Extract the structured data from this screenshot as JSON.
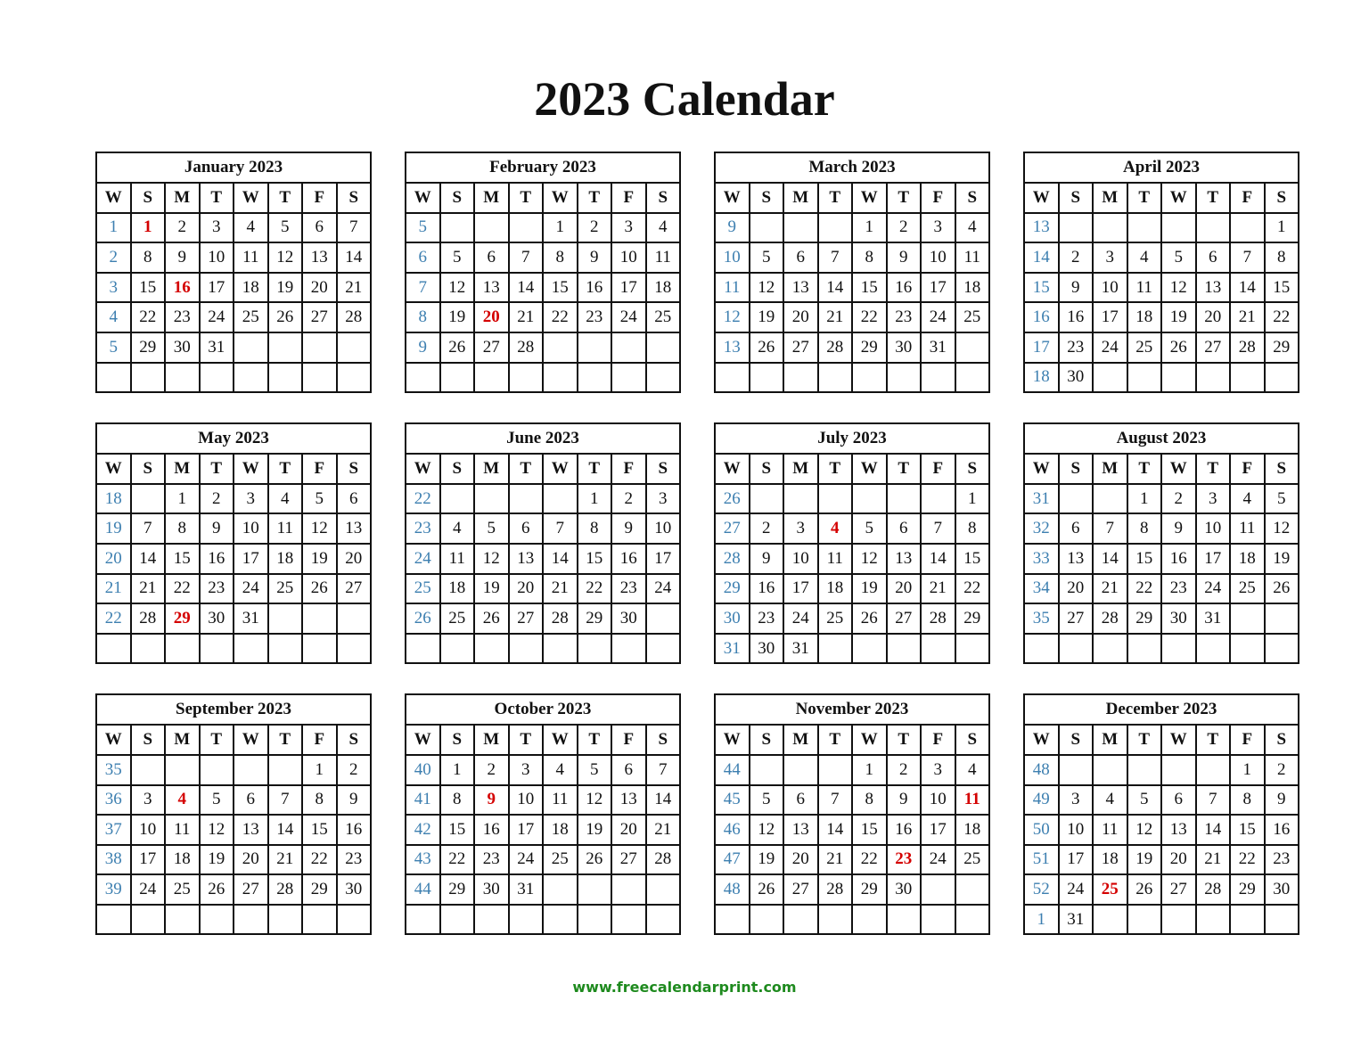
{
  "title": "2023 Calendar",
  "footer": "www.freecalendarprint.com",
  "weekday_headers": [
    "W",
    "S",
    "M",
    "T",
    "W",
    "T",
    "F",
    "S"
  ],
  "colors": {
    "holiday": "#d40000",
    "week_number": "#3d7fb0",
    "footer": "#1e8a1e"
  },
  "months": [
    {
      "name": "January 2023",
      "offset": 0,
      "days": 31,
      "first_week": 1,
      "holidays": [
        1,
        16
      ]
    },
    {
      "name": "February 2023",
      "offset": 3,
      "days": 28,
      "first_week": 5,
      "holidays": [
        20
      ]
    },
    {
      "name": "March 2023",
      "offset": 3,
      "days": 31,
      "first_week": 9,
      "holidays": []
    },
    {
      "name": "April 2023",
      "offset": 6,
      "days": 30,
      "first_week": 13,
      "holidays": []
    },
    {
      "name": "May 2023",
      "offset": 1,
      "days": 31,
      "first_week": 18,
      "holidays": [
        29
      ]
    },
    {
      "name": "June 2023",
      "offset": 4,
      "days": 30,
      "first_week": 22,
      "holidays": []
    },
    {
      "name": "July 2023",
      "offset": 6,
      "days": 31,
      "first_week": 26,
      "holidays": [
        4
      ]
    },
    {
      "name": "August 2023",
      "offset": 2,
      "days": 31,
      "first_week": 31,
      "holidays": []
    },
    {
      "name": "September 2023",
      "offset": 5,
      "days": 30,
      "first_week": 35,
      "holidays": [
        4
      ]
    },
    {
      "name": "October 2023",
      "offset": 0,
      "days": 31,
      "first_week": 40,
      "holidays": [
        9
      ]
    },
    {
      "name": "November 2023",
      "offset": 3,
      "days": 30,
      "first_week": 44,
      "holidays": [
        11,
        23
      ]
    },
    {
      "name": "December 2023",
      "offset": 5,
      "days": 31,
      "first_week": 48,
      "holidays": [
        25
      ]
    }
  ]
}
